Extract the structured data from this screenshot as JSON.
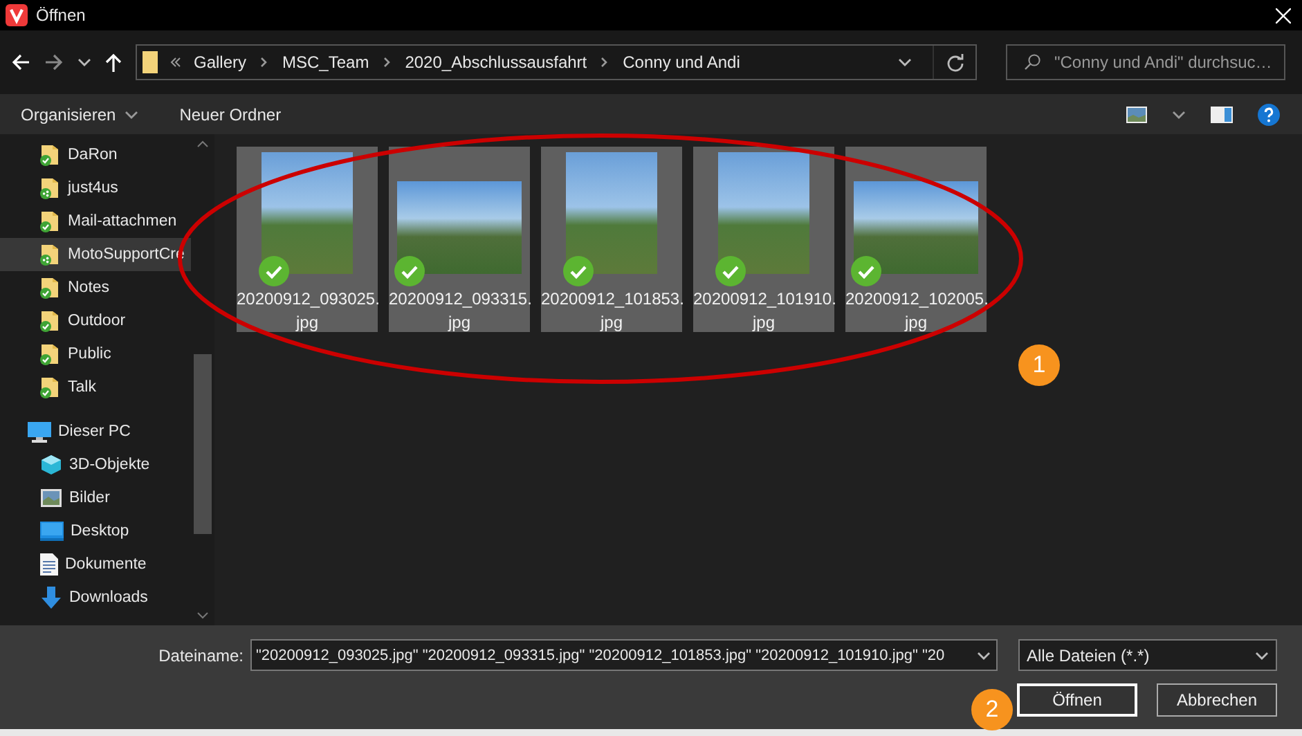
{
  "window": {
    "title": "Öffnen"
  },
  "address_bar": {
    "crumbs": [
      "Gallery",
      "MSC_Team",
      "2020_Abschlussausfahrt",
      "Conny und Andi"
    ]
  },
  "search": {
    "placeholder": "\"Conny und Andi\" durchsuc…"
  },
  "toolbar": {
    "organize": "Organisieren",
    "new_folder": "Neuer Ordner"
  },
  "sidebar": {
    "items": [
      {
        "label": "DaRon",
        "kind": "synced",
        "selected": false
      },
      {
        "label": "just4us",
        "kind": "shared",
        "selected": false
      },
      {
        "label": "Mail-attachmen",
        "kind": "synced",
        "selected": false
      },
      {
        "label": "MotoSupportCre",
        "kind": "shared",
        "selected": true
      },
      {
        "label": "Notes",
        "kind": "synced",
        "selected": false
      },
      {
        "label": "Outdoor",
        "kind": "synced",
        "selected": false
      },
      {
        "label": "Public",
        "kind": "synced",
        "selected": false
      },
      {
        "label": "Talk",
        "kind": "synced",
        "selected": false
      }
    ],
    "this_pc": {
      "label": "Dieser PC",
      "children": [
        {
          "label": "3D-Objekte",
          "kind": "objects"
        },
        {
          "label": "Bilder",
          "kind": "pictures"
        },
        {
          "label": "Desktop",
          "kind": "desktop"
        },
        {
          "label": "Dokumente",
          "kind": "documents"
        },
        {
          "label": "Downloads",
          "kind": "downloads"
        }
      ]
    }
  },
  "files": [
    {
      "name": "20200912_093025.jpg",
      "kind": "portrait",
      "selected": true
    },
    {
      "name": "20200912_093315.jpg",
      "kind": "landscape",
      "selected": true
    },
    {
      "name": "20200912_101853.jpg",
      "kind": "portrait",
      "selected": true
    },
    {
      "name": "20200912_101910.jpg",
      "kind": "portrait",
      "selected": true
    },
    {
      "name": "20200912_102005.jpg",
      "kind": "landscape",
      "selected": true
    }
  ],
  "footer": {
    "filename_label": "Dateiname:",
    "filename_value": "\"20200912_093025.jpg\" \"20200912_093315.jpg\" \"20200912_101853.jpg\" \"20200912_101910.jpg\" \"20",
    "file_type": "Alle Dateien (*.*)",
    "buttons": [
      {
        "label": "Öffnen",
        "default": true
      },
      {
        "label": "Abbrechen",
        "default": false
      }
    ]
  },
  "annotations": [
    {
      "label": "1"
    },
    {
      "label": "2"
    }
  ]
}
